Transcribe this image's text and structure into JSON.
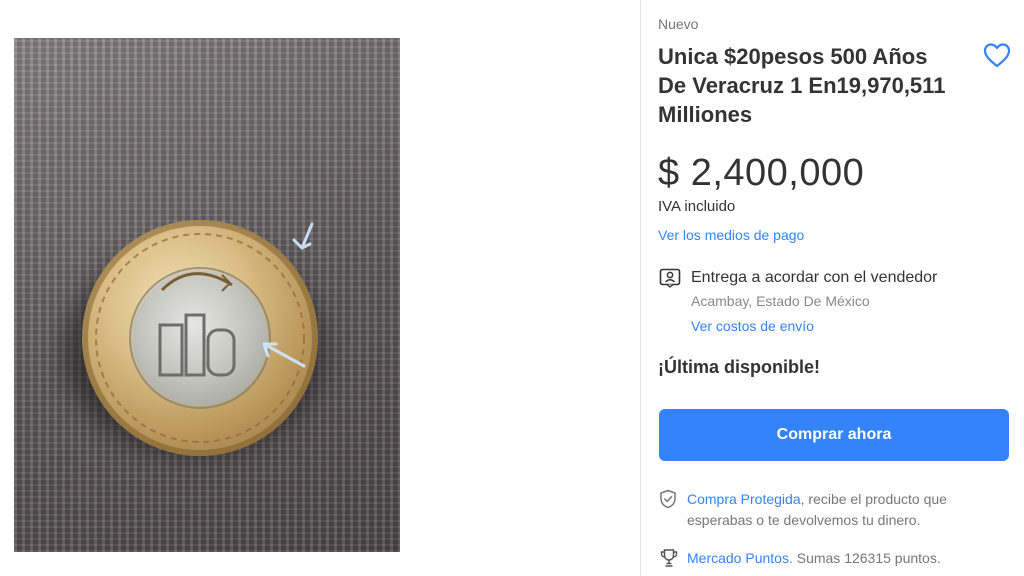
{
  "listing": {
    "condition": "Nuevo",
    "title": "Unica $20pesos 500 Años De Veracruz 1 En19,970,511 Milliones",
    "price": "$ 2,400,000",
    "tax_note": "IVA incluido",
    "payment_link": "Ver los medios de pago"
  },
  "shipping": {
    "title": "Entrega a acordar con el vendedor",
    "location": "Acambay, Estado De México",
    "cost_link": "Ver costos de envío"
  },
  "stock": {
    "label": "¡Última disponible!"
  },
  "actions": {
    "buy_now": "Comprar ahora"
  },
  "protection": {
    "link": "Compra Protegida",
    "text": ", recibe el producto que esperabas o te devolvemos tu dinero."
  },
  "points": {
    "link": "Mercado Puntos",
    "text": ". Sumas 126315 puntos."
  },
  "icons": {
    "favorite": "heart-icon",
    "shipping": "person-card-icon",
    "protection": "shield-check-icon",
    "points": "trophy-icon"
  },
  "colors": {
    "accent": "#3483fa",
    "text": "#333333",
    "muted": "#777777"
  }
}
